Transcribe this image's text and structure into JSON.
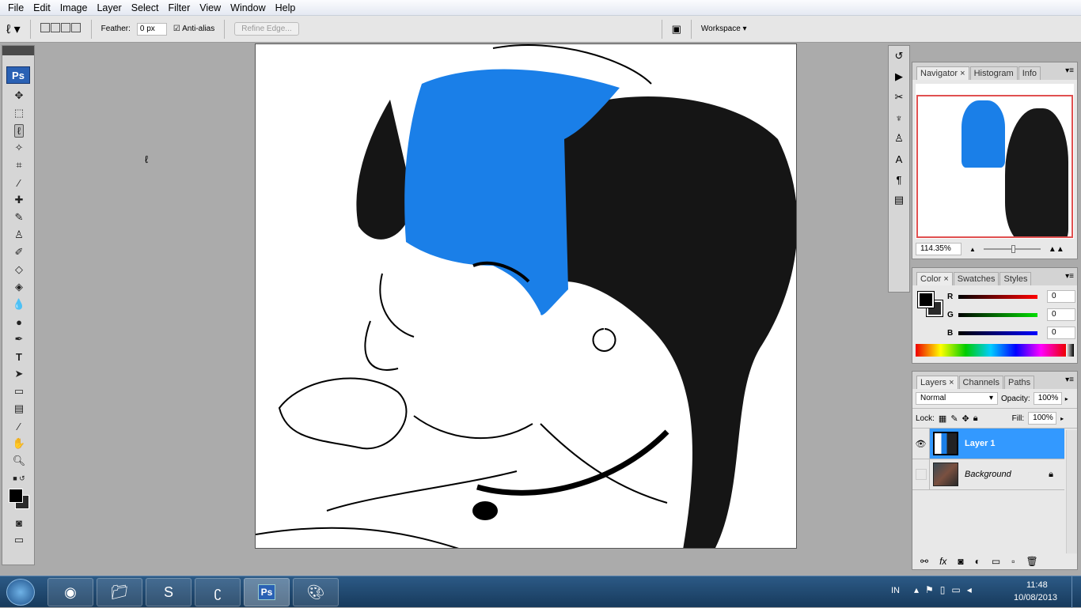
{
  "menu": [
    "File",
    "Edit",
    "Image",
    "Layer",
    "Select",
    "Filter",
    "View",
    "Window",
    "Help"
  ],
  "options": {
    "feather_label": "Feather:",
    "feather_value": "0 px",
    "antialias_label": "Anti-alias",
    "antialias_checked": true,
    "refine_edge": "Refine Edge...",
    "workspace": "Workspace ▾"
  },
  "tools": {
    "logo": "Ps",
    "active": "lasso"
  },
  "navigator": {
    "tabs": [
      "Navigator",
      "Histogram",
      "Info"
    ],
    "zoom": "114.35%"
  },
  "color": {
    "tabs": [
      "Color",
      "Swatches",
      "Styles"
    ],
    "r_label": "R",
    "g_label": "G",
    "b_label": "B",
    "r": "0",
    "g": "0",
    "b": "0",
    "foreground": "#000000",
    "background": "#2a2a2a"
  },
  "layers": {
    "tabs": [
      "Layers",
      "Channels",
      "Paths"
    ],
    "blend_mode": "Normal",
    "opacity_label": "Opacity:",
    "opacity": "100%",
    "lock_label": "Lock:",
    "fill_label": "Fill:",
    "fill": "100%",
    "items": [
      {
        "name": "Layer 1",
        "selected": true,
        "visible": true
      },
      {
        "name": "Background",
        "selected": false,
        "visible": false,
        "locked": true
      }
    ]
  },
  "taskbar": {
    "lang": "IN",
    "time": "11:48",
    "date": "10/08/2013",
    "apps": [
      "chrome",
      "explorer",
      "skype",
      "app",
      "photoshop",
      "paint"
    ]
  },
  "colors": {
    "accent": "#3399ff",
    "hair_blue": "#1a7fe8"
  }
}
